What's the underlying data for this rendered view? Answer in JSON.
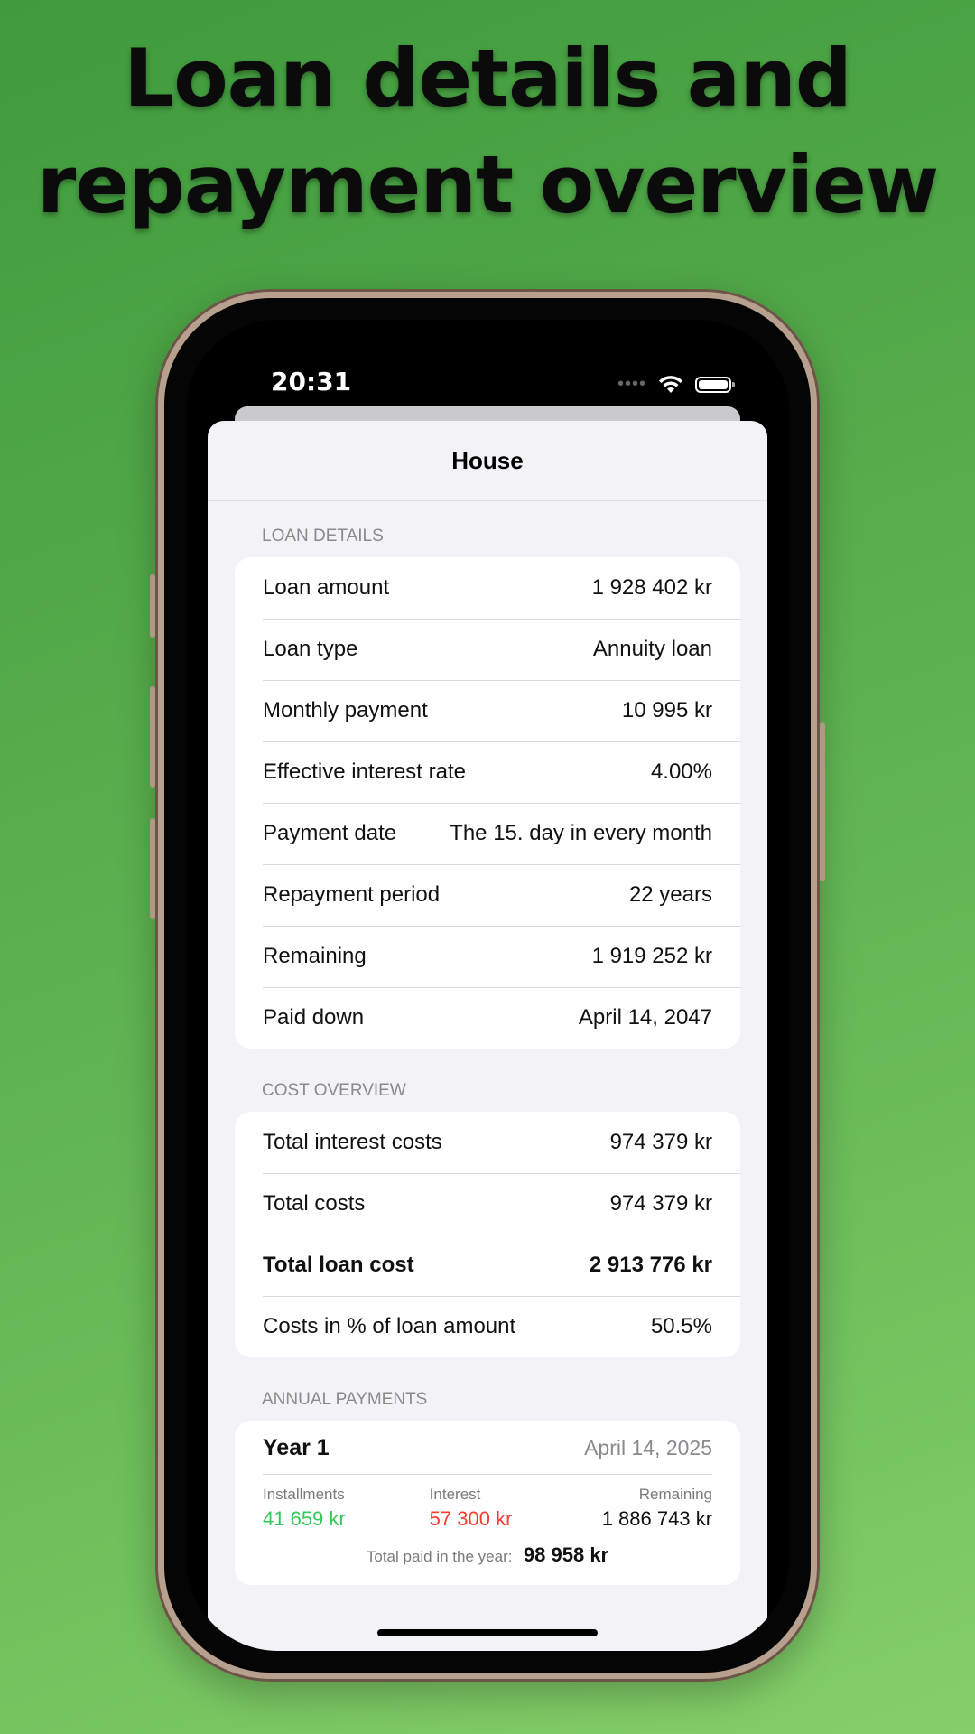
{
  "headline": {
    "line1": "Loan details and",
    "line2": "repayment overview"
  },
  "status_bar": {
    "time": "20:31"
  },
  "sheet": {
    "title": "House"
  },
  "loan_details": {
    "header": "LOAN DETAILS",
    "rows": [
      {
        "label": "Loan amount",
        "value": "1 928 402 kr"
      },
      {
        "label": "Loan type",
        "value": "Annuity loan"
      },
      {
        "label": "Monthly payment",
        "value": "10 995 kr"
      },
      {
        "label": "Effective interest rate",
        "value": "4.00%"
      },
      {
        "label": "Payment date",
        "value": "The 15. day in every month"
      },
      {
        "label": "Repayment period",
        "value": "22 years"
      },
      {
        "label": "Remaining",
        "value": "1 919 252 kr"
      },
      {
        "label": "Paid down",
        "value": "April 14, 2047"
      }
    ]
  },
  "cost_overview": {
    "header": "COST OVERVIEW",
    "rows": [
      {
        "label": "Total interest costs",
        "value": "974 379 kr"
      },
      {
        "label": "Total costs",
        "value": "974 379 kr"
      },
      {
        "label": "Total loan cost",
        "value": "2 913 776 kr"
      },
      {
        "label": "Costs in % of loan amount",
        "value": "50.5%"
      }
    ]
  },
  "annual_payments": {
    "header": "ANNUAL PAYMENTS",
    "years": [
      {
        "title": "Year 1",
        "date": "April 14, 2025",
        "installments_label": "Installments",
        "installments": "41 659 kr",
        "interest_label": "Interest",
        "interest": "57 300 kr",
        "remaining_label": "Remaining",
        "remaining": "1 886 743 kr",
        "total_label": "Total paid in the year:",
        "total": "98 958 kr"
      }
    ]
  },
  "colors": {
    "installments": "#34c759",
    "interest": "#ff3b30",
    "background_green": "#58ad4c"
  }
}
